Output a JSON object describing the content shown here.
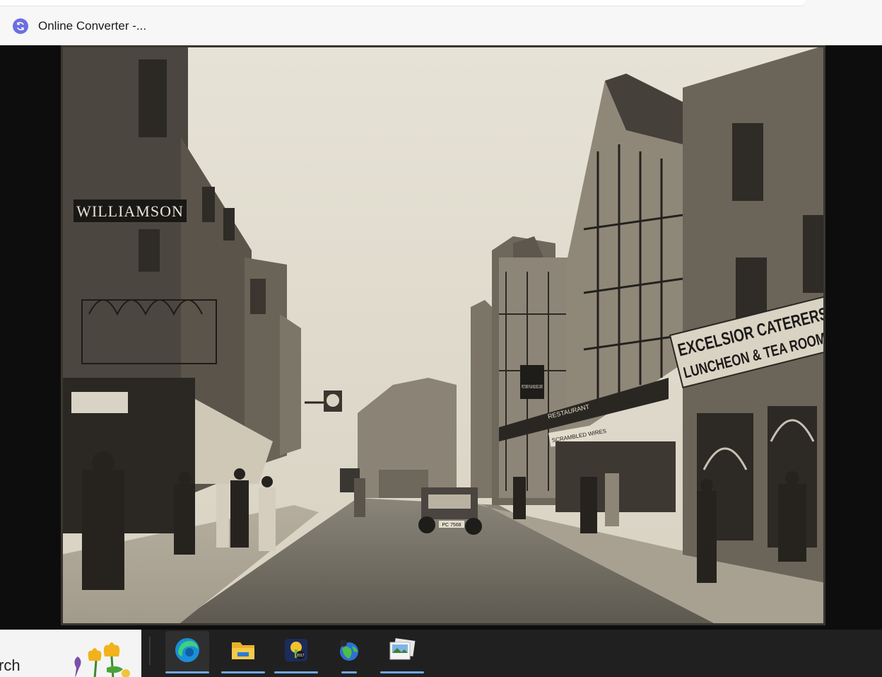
{
  "browser": {
    "tab_title": "Online Converter -...",
    "tab_icon": "converter-refresh-icon"
  },
  "photo": {
    "subject": "vintage-street-photograph",
    "signs": {
      "shop_left": "WILLIAMSON",
      "caterers_line1": "EXCELSIOR CATERERS",
      "caterers_line2": "LUNCHEON & TEA ROOMS",
      "cafe": "PICTURE PLAYHOUSE CAFE",
      "restaurant": "RESTAURANT",
      "scrambled": "SCRAMBLED WIRES",
      "number_plate": "PC 7568"
    }
  },
  "taskbar": {
    "search_text": "rch",
    "apps": [
      {
        "name": "edge",
        "icon": "edge-icon"
      },
      {
        "name": "file-explorer",
        "icon": "folder-icon"
      },
      {
        "name": "photo-app-2017",
        "icon": "tree-2017-icon"
      },
      {
        "name": "globe-app",
        "icon": "globe-icon"
      },
      {
        "name": "photos",
        "icon": "photos-icon"
      }
    ]
  },
  "colors": {
    "accent": "#6fa8e6",
    "taskbar": "#202020",
    "viewer_bg": "#0d0d0d",
    "sepia": "#cfc8b7"
  }
}
